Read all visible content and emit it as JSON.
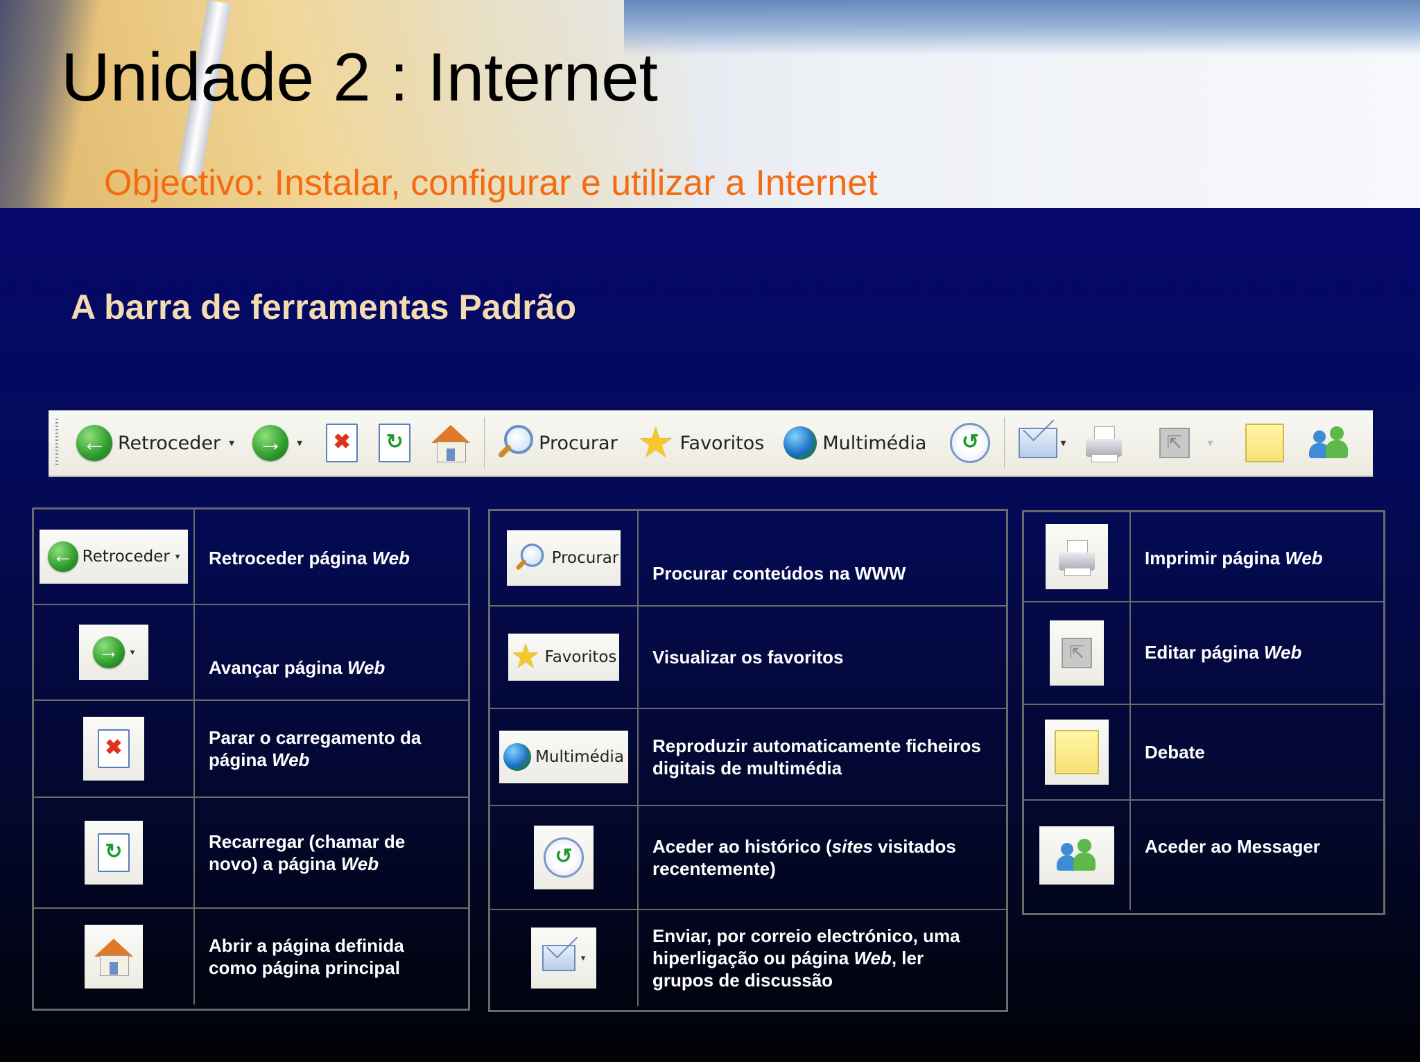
{
  "slide": {
    "title": "Unidade 2 : Internet",
    "subtitle": "Objectivo: Instalar, configurar e utilizar a Internet",
    "section_title": "A barra de ferramentas Padrão"
  },
  "toolbar": {
    "back_label": "Retroceder",
    "search_label": "Procurar",
    "favorites_label": "Favoritos",
    "media_label": "Multimédia",
    "dropdown_glyph": "▾"
  },
  "icons": {
    "back": "back-arrow-icon",
    "forward": "forward-arrow-icon",
    "stop": "stop-icon",
    "refresh": "refresh-icon",
    "home": "home-icon",
    "search": "search-icon",
    "favorites": "star-icon",
    "media": "globe-icon",
    "history": "history-icon",
    "mail": "mail-icon",
    "print": "printer-icon",
    "edit": "edit-icon",
    "discuss": "note-icon",
    "messenger": "messenger-icon"
  },
  "table1": {
    "rows": [
      {
        "button_label": "Retroceder",
        "text_a": "Retroceder página ",
        "text_em": "Web",
        "text_b": ""
      },
      {
        "button_label": "",
        "text_a": "Avançar página ",
        "text_em": "Web",
        "text_b": ""
      },
      {
        "button_label": "",
        "text_a": "Parar o carregamento da página ",
        "text_em": "Web",
        "text_b": ""
      },
      {
        "button_label": "",
        "text_a": "Recarregar (chamar de novo) a página ",
        "text_em": "Web",
        "text_b": ""
      },
      {
        "button_label": "",
        "text_a": "Abrir a página definida como página principal",
        "text_em": "",
        "text_b": ""
      }
    ]
  },
  "table2": {
    "rows": [
      {
        "button_label": "Procurar",
        "text_a": "Procurar conteúdos na WWW",
        "text_em": "",
        "text_b": ""
      },
      {
        "button_label": "Favoritos",
        "text_a": "Visualizar os favoritos",
        "text_em": "",
        "text_b": ""
      },
      {
        "button_label": "Multimédia",
        "text_a": "Reproduzir automaticamente ficheiros digitais de multimédia",
        "text_em": "",
        "text_b": ""
      },
      {
        "button_label": "",
        "text_a": "Aceder ao histórico (",
        "text_em": "sites",
        "text_b": " visitados recentemente)"
      },
      {
        "button_label": "",
        "text_a": "Enviar, por correio electrónico, uma hiperligação ou página ",
        "text_em": "Web",
        "text_b": ", ler grupos de discussão"
      }
    ]
  },
  "table3": {
    "rows": [
      {
        "text_a": "Imprimir página ",
        "text_em": "Web"
      },
      {
        "text_a": "Editar página ",
        "text_em": "Web"
      },
      {
        "text_a": "Debate",
        "text_em": ""
      },
      {
        "text_a": "Aceder ao Messager",
        "text_em": ""
      }
    ]
  },
  "colors": {
    "title": "#000000",
    "subtitle": "#f46b12",
    "section_title": "#f3dcb0",
    "background_top": "#05086a",
    "background_bottom": "#010207",
    "table_border": "#6a6a6a"
  }
}
